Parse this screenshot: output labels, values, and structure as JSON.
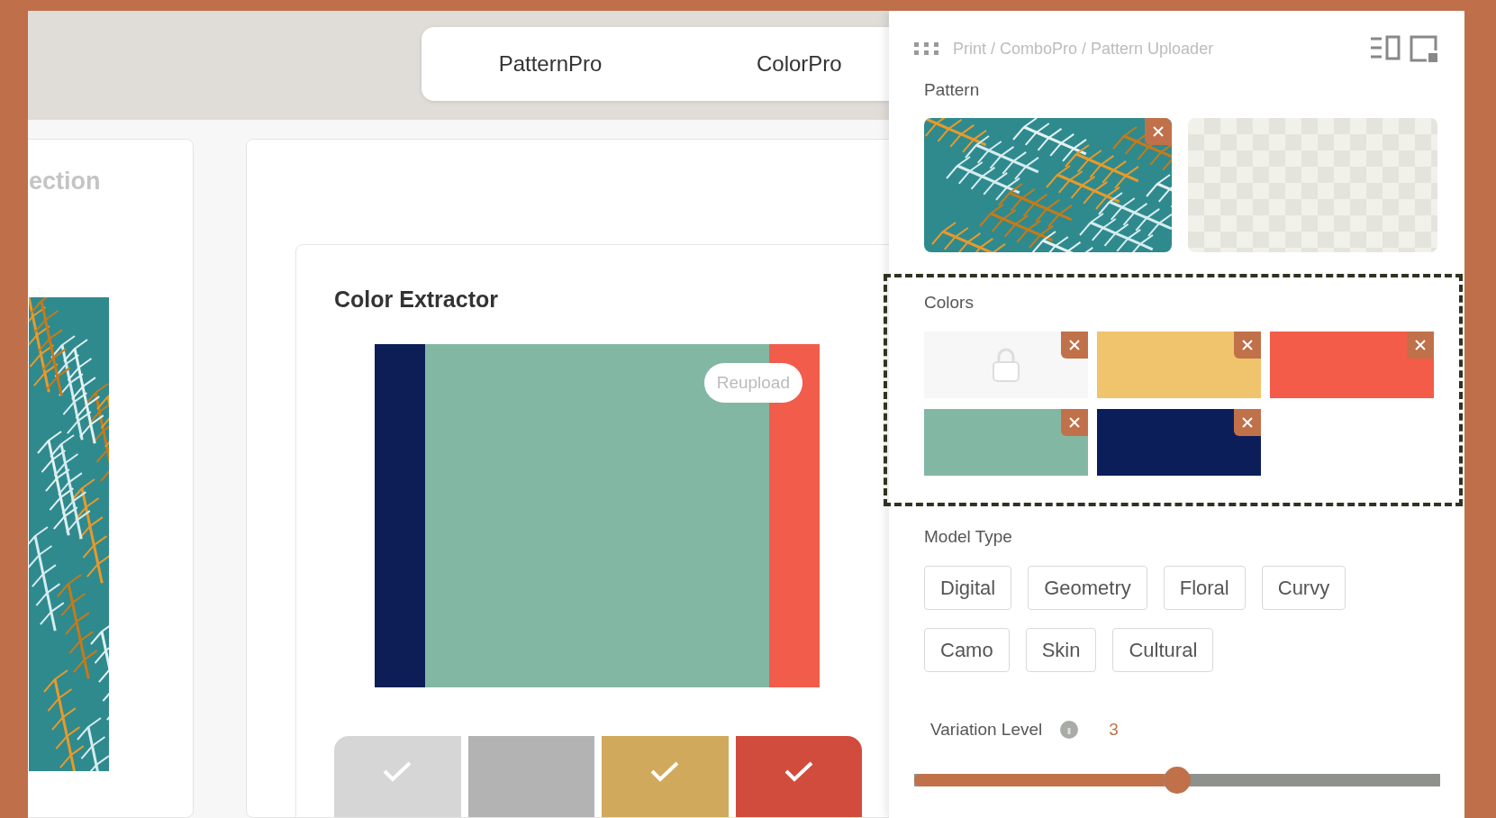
{
  "tabs": [
    {
      "label": "PatternPro"
    },
    {
      "label": "ColorPro"
    }
  ],
  "left_card": {
    "heading": "ection"
  },
  "color_extractor": {
    "title": "Color Extractor",
    "stripes": [
      {
        "kind": "narrow",
        "color": "#0c1e55"
      },
      {
        "kind": "wide",
        "color": "#82b8a3"
      },
      {
        "kind": "narrow",
        "color": "#f25c4b"
      }
    ],
    "reupload": "Reupload",
    "swatches": [
      {
        "color": "#d6d6d6",
        "checked": true
      },
      {
        "color": "#b3b3b3",
        "checked": false
      },
      {
        "color": "#d0a95d",
        "checked": true
      },
      {
        "color": "#d24c3d",
        "checked": true
      }
    ]
  },
  "panel": {
    "breadcrumb": "Print / ComboPro / Pattern Uploader",
    "pattern": {
      "label": "Pattern",
      "slots": [
        {
          "kind": "image"
        },
        {
          "kind": "empty"
        }
      ]
    },
    "colors": {
      "label": "Colors",
      "slots": [
        {
          "kind": "locked"
        },
        {
          "kind": "color",
          "color": "#f0c46c"
        },
        {
          "kind": "color",
          "color": "#f25c48"
        },
        {
          "kind": "color",
          "color": "#82b8a3"
        },
        {
          "kind": "color",
          "color": "#0c1e5a"
        }
      ]
    },
    "model_type": {
      "label": "Model Type",
      "options": [
        {
          "label": "Digital"
        },
        {
          "label": "Geometry"
        },
        {
          "label": "Floral"
        },
        {
          "label": "Curvy"
        },
        {
          "label": "Camo"
        },
        {
          "label": "Skin"
        },
        {
          "label": "Cultural"
        }
      ]
    },
    "variation": {
      "label": "Variation Level",
      "value": "3",
      "level": 0.5
    }
  }
}
